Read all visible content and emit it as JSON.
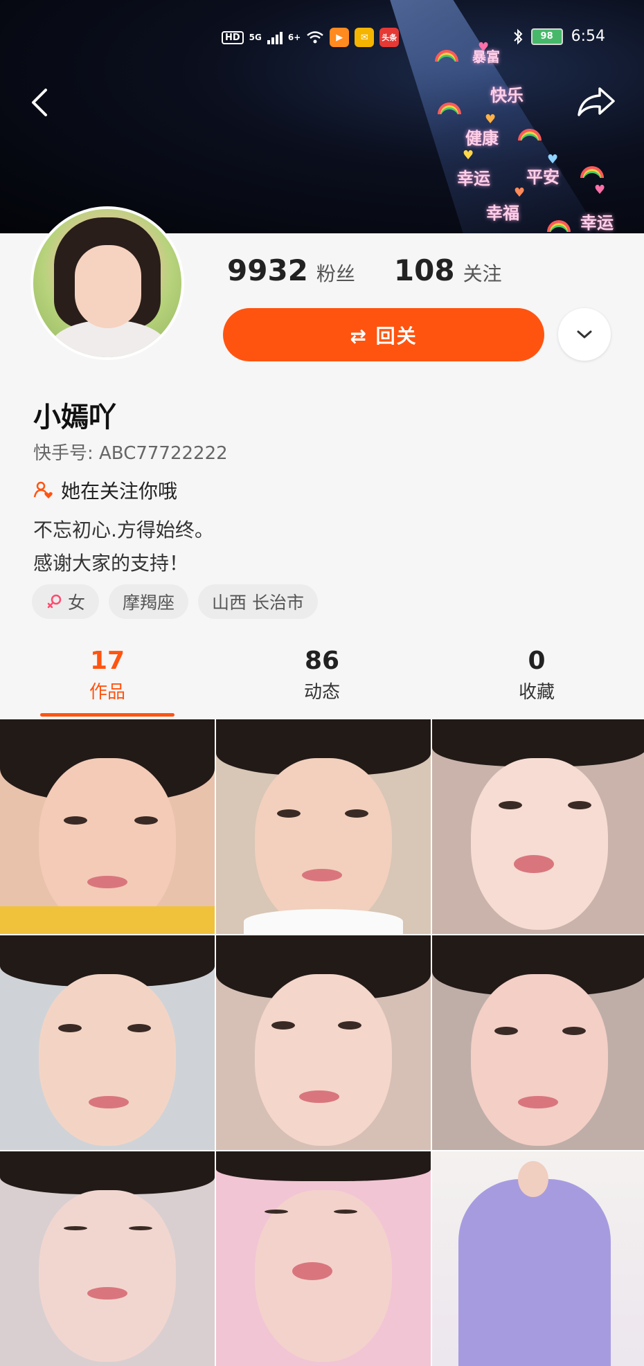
{
  "status_bar": {
    "hd": "HD",
    "network": "5G",
    "signal2": "6+",
    "app1": "▶",
    "app2": "✉",
    "app3": "头条",
    "battery": "98",
    "time": "6:54"
  },
  "banner": {
    "words": [
      "暴富",
      "快乐",
      "健康",
      "幸运",
      "平安",
      "幸福",
      "幸运"
    ]
  },
  "profile": {
    "followers_count": "9932",
    "followers_label": "粉丝",
    "following_count": "108",
    "following_label": "关注",
    "follow_back_label": "⇄ 回关",
    "name": "小嫣吖",
    "kuaishou_id": "快手号: ABC77722222",
    "mutual_text": "她在关注你哦",
    "bio_line1": "不忘初心.方得始终。",
    "bio_line2": "感谢大家的支持！",
    "tags": {
      "gender": "女",
      "zodiac": "摩羯座",
      "location": "山西 长治市"
    }
  },
  "tabs": [
    {
      "count": "17",
      "label": "作品"
    },
    {
      "count": "86",
      "label": "动态"
    },
    {
      "count": "0",
      "label": "收藏"
    }
  ],
  "colors": {
    "accent": "#ff5410"
  },
  "icons": {
    "back": "chevron-left-icon",
    "share": "share-arrow-icon",
    "more": "chevron-down-icon",
    "mutual": "user-heart-icon",
    "gender": "female-icon"
  }
}
